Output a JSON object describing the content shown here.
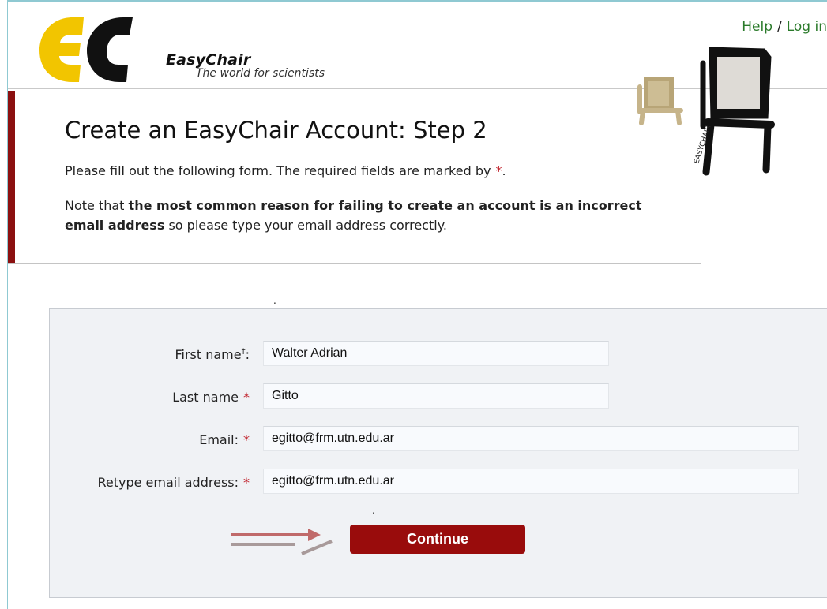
{
  "logo": {
    "name": "EasyChair",
    "tagline": "The world for scientists",
    "letters": "EC"
  },
  "toplinks": {
    "help": "Help",
    "separator": "/",
    "login": "Log in"
  },
  "header": {
    "title": "Create an EasyChair Account: Step 2",
    "intro": "Please fill out the following form. The required fields are marked by",
    "required_marker": "*",
    "intro_end": ".",
    "note_prefix": "Note that",
    "note_bold": "the most common reason for failing to create an account is an incorrect email address",
    "note_suffix": "so please type your email address correctly."
  },
  "chair_text": "EASYCHAIR",
  "form": {
    "first_name_label": "First name",
    "first_name_mark": "†",
    "first_name_colon": ":",
    "first_name_value": "Walter Adrian",
    "last_name_label": "Last name",
    "last_name_value": "Gitto",
    "email_label": "Email:",
    "email_value": "egitto@frm.utn.edu.ar",
    "retype_label": "Retype email address:",
    "retype_value": "egitto@frm.utn.edu.ar",
    "star": "*",
    "continue_label": "Continue"
  },
  "colors": {
    "accent_red": "#990c0c",
    "header_bar": "#8b1010",
    "link_green": "#2a7a2a",
    "required_star": "#c0202a",
    "arrow": "#c06a6a"
  }
}
